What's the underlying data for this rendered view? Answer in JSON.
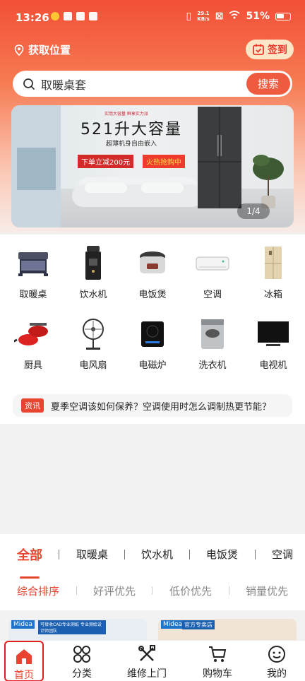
{
  "status": {
    "time": "13:26",
    "speed_top": "29.1",
    "speed_bottom": "KB/s",
    "battery": "51%"
  },
  "header": {
    "location": "获取位置",
    "signin": "签到"
  },
  "search": {
    "placeholder": "取暖桌套",
    "button": "搜索"
  },
  "banner": {
    "tagline": "实用大容量 鲜享实力派",
    "title": "521升大容量",
    "subtitle": "超薄机身自由嵌入",
    "tag_discount": "下单立减200元",
    "tag_hot": "火热抢购中",
    "counter": "1/4"
  },
  "categories": [
    {
      "label": "取暖桌",
      "icon": "heater-table-icon"
    },
    {
      "label": "饮水机",
      "icon": "water-dispenser-icon"
    },
    {
      "label": "电饭煲",
      "icon": "rice-cooker-icon"
    },
    {
      "label": "空调",
      "icon": "air-conditioner-icon"
    },
    {
      "label": "冰箱",
      "icon": "fridge-icon"
    },
    {
      "label": "厨具",
      "icon": "cookware-icon"
    },
    {
      "label": "电风扇",
      "icon": "fan-icon"
    },
    {
      "label": "电磁炉",
      "icon": "induction-cooker-icon"
    },
    {
      "label": "洗衣机",
      "icon": "washing-machine-icon"
    },
    {
      "label": "电视机",
      "icon": "tv-icon"
    }
  ],
  "news": {
    "badge": "资讯",
    "text": "夏季空调该如何保养？空调使用时怎么调制热更节能？"
  },
  "tabs": [
    "全部",
    "取暖桌",
    "饮水机",
    "电饭煲",
    "空调"
  ],
  "sort": [
    "综合排序",
    "好评优先",
    "低价优先",
    "销量优先"
  ],
  "products": [
    {
      "brand": "Midea",
      "label": "可接收CAD专业测纸 专业测绘设计师团队"
    },
    {
      "brand": "Midea",
      "label": "官方专卖店"
    }
  ],
  "bottom_nav": [
    "首页",
    "分类",
    "维修上门",
    "购物车",
    "我的"
  ],
  "colors": {
    "accent": "#e8442f",
    "header_top": "#f24f37"
  }
}
